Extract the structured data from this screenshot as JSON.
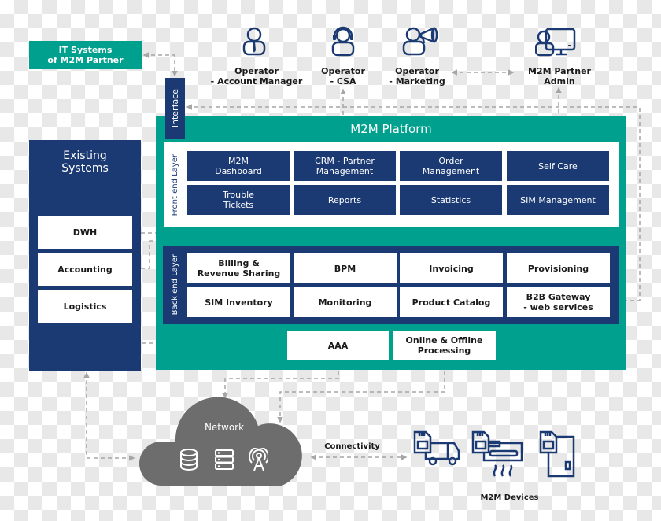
{
  "colors": {
    "teal": "#00a08f",
    "navy": "#1b3a73",
    "cloud": "#6d6d6d",
    "connector": "#a6a6a6"
  },
  "it_partner": {
    "label_line1": "IT Systems",
    "label_line2": "of M2M Partner"
  },
  "interface": {
    "label": "Interface"
  },
  "actors": [
    {
      "icon": "operator-tie-icon",
      "line1": "Operator",
      "line2": "- Account Manager"
    },
    {
      "icon": "operator-headset-icon",
      "line1": "Operator",
      "line2": "- CSA"
    },
    {
      "icon": "operator-megaphone-icon",
      "line1": "Operator",
      "line2": "- Marketing"
    },
    {
      "icon": "partner-admin-computer-icon",
      "line1": "M2M Partner",
      "line2": "Admin"
    }
  ],
  "platform": {
    "title": "M2M Platform",
    "front_end": {
      "label": "Front end Layer",
      "tiles": [
        {
          "line1": "M2M",
          "line2": "Dashboard"
        },
        {
          "line1": "CRM - Partner",
          "line2": "Management"
        },
        {
          "line1": "Order",
          "line2": "Management"
        },
        {
          "line1": "Self Care",
          "line2": ""
        },
        {
          "line1": "Trouble",
          "line2": "Tickets"
        },
        {
          "line1": "Reports",
          "line2": ""
        },
        {
          "line1": "Statistics",
          "line2": ""
        },
        {
          "line1": "SIM Management",
          "line2": ""
        }
      ]
    },
    "back_end": {
      "label": "Back end Layer",
      "tiles": [
        {
          "line1": "Billing &",
          "line2": "Revenue Sharing"
        },
        {
          "line1": "BPM",
          "line2": ""
        },
        {
          "line1": "Invoicing",
          "line2": ""
        },
        {
          "line1": "Provisioning",
          "line2": ""
        },
        {
          "line1": "SIM Inventory",
          "line2": ""
        },
        {
          "line1": "Monitoring",
          "line2": ""
        },
        {
          "line1": "Product Catalog",
          "line2": ""
        },
        {
          "line1": "B2B Gateway",
          "line2": "- web services"
        }
      ]
    },
    "aaa": {
      "label": "AAA"
    },
    "online_offline": {
      "line1": "Online & Offline",
      "line2": "Processing"
    }
  },
  "existing_systems": {
    "title_line1": "Existing",
    "title_line2": "Systems",
    "items": [
      "DWH",
      "Accounting",
      "Logistics"
    ]
  },
  "network": {
    "label": "Network",
    "icons": [
      "database-icon",
      "server-icon",
      "antenna-icon"
    ]
  },
  "connectivity": {
    "label": "Connectivity"
  },
  "devices": {
    "label": "M2M Devices",
    "icons": [
      "sim-truck-icon",
      "sim-air-conditioner-icon",
      "sim-meter-icon"
    ]
  }
}
